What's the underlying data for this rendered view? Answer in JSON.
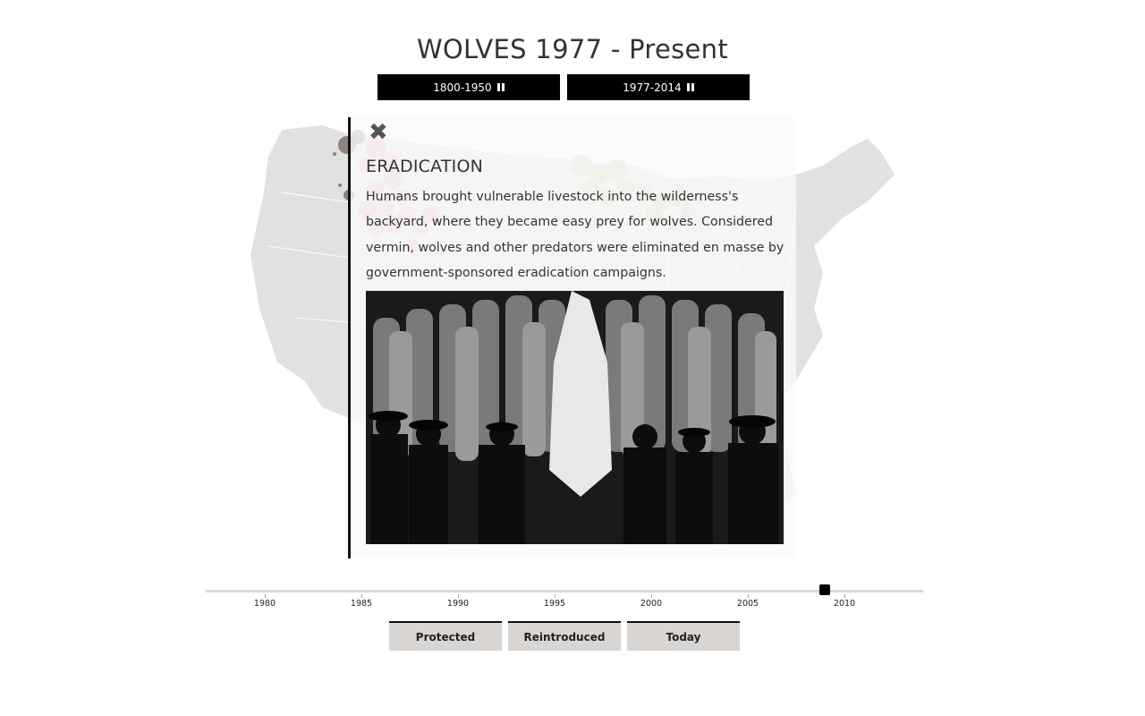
{
  "page": {
    "title": "WOLVES 1977 - Present"
  },
  "era_buttons": [
    {
      "label": "1800-1950",
      "icon": "pause-icon"
    },
    {
      "label": "1977-2014",
      "icon": "pause-icon"
    }
  ],
  "map": {
    "icon": "us-map",
    "colors": {
      "land": "#e0e0e0",
      "state_lines": "#ffffff",
      "west_cluster": "#e8a0b0",
      "central_cluster": "#c9c59a",
      "dark_points": "#6b5a52"
    }
  },
  "panel": {
    "close_icon": "close-icon",
    "heading": "ERADICATION",
    "body": "Humans brought vulnerable livestock into the wilderness's backyard, where they became easy prey for wolves. Considered vermin, wolves and other predators were eliminated en masse by government-sponsored eradication campaigns.",
    "photo": "black-and-white photo of men posing with wolf pelts"
  },
  "timeline": {
    "ticks": [
      "1980",
      "1985",
      "1990",
      "1995",
      "2000",
      "2005",
      "2010"
    ],
    "current_year": 2009,
    "colors": {
      "track": "#d9d9d9",
      "handle": "#000000"
    }
  },
  "stage_buttons": [
    {
      "label": "Protected"
    },
    {
      "label": "Reintroduced"
    },
    {
      "label": "Today"
    }
  ]
}
